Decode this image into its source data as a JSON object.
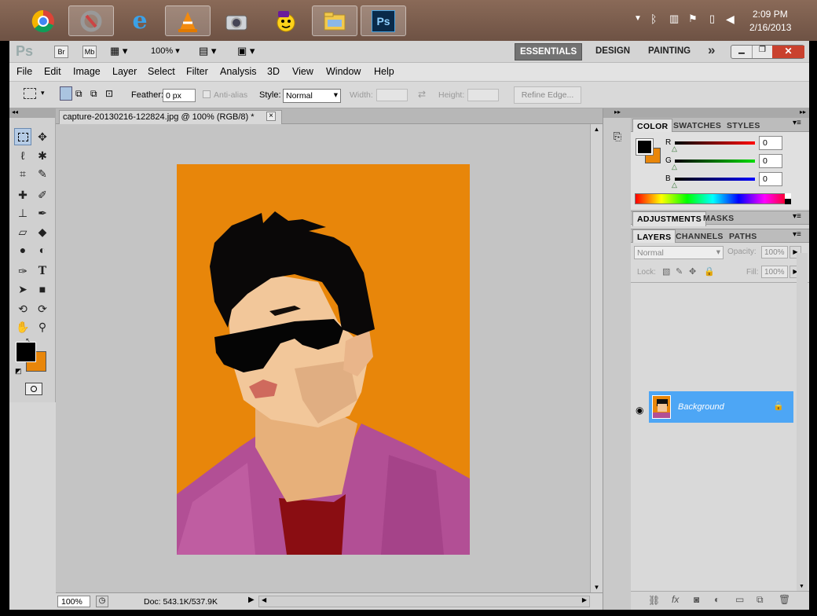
{
  "taskbar": {
    "apps": [
      {
        "name": "chrome",
        "pinned": false
      },
      {
        "name": "app2",
        "pinned": true
      },
      {
        "name": "internet-explorer",
        "pinned": false
      },
      {
        "name": "vlc",
        "pinned": true
      },
      {
        "name": "camera",
        "pinned": false
      },
      {
        "name": "yahoo-messenger",
        "pinned": false
      },
      {
        "name": "file-explorer",
        "pinned": true
      },
      {
        "name": "photoshop",
        "pinned": true
      }
    ],
    "ps_label": "Ps",
    "clock_time": "2:09 PM",
    "clock_date": "2/16/2013"
  },
  "appbar": {
    "logo": "Ps",
    "br": "Br",
    "mb": "Mb",
    "zoom": "100%",
    "workspaces": [
      "ESSENTIALS",
      "DESIGN",
      "PAINTING"
    ],
    "more": "»"
  },
  "menubar": [
    "File",
    "Edit",
    "Image",
    "Layer",
    "Select",
    "Filter",
    "Analysis",
    "3D",
    "View",
    "Window",
    "Help"
  ],
  "options": {
    "feather_label": "Feather:",
    "feather_value": "0 px",
    "antialias_label": "Anti-alias",
    "style_label": "Style:",
    "style_value": "Normal",
    "width_label": "Width:",
    "height_label": "Height:",
    "refine_edge": "Refine Edge..."
  },
  "document": {
    "tab_title": "capture-20130216-122824.jpg @ 100% (RGB/8) *",
    "close": "×",
    "zoom": "100%",
    "doc_info": "Doc: 543.1K/537.9K"
  },
  "colors": {
    "orange": "#e8860a",
    "foreground": "#000000",
    "background": "#e8860a",
    "highlight": "#4da6f5"
  },
  "color_panel": {
    "tabs": [
      "COLOR",
      "SWATCHES",
      "STYLES"
    ],
    "channels": [
      {
        "label": "R",
        "value": "0"
      },
      {
        "label": "G",
        "value": "0"
      },
      {
        "label": "B",
        "value": "0"
      }
    ]
  },
  "adjust_panel": {
    "tabs": [
      "ADJUSTMENTS",
      "MASKS"
    ]
  },
  "layers_panel": {
    "tabs": [
      "LAYERS",
      "CHANNELS",
      "PATHS"
    ],
    "blend_mode": "Normal",
    "opacity_label": "Opacity:",
    "opacity_value": "100%",
    "lock_label": "Lock:",
    "fill_label": "Fill:",
    "fill_value": "100%",
    "layer_name": "Background"
  }
}
